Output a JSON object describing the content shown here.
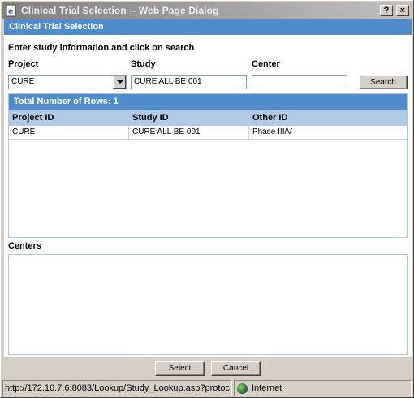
{
  "window": {
    "title": "Clinical Trial Selection -- Web Page Dialog",
    "help_label": "?",
    "close_label": "×"
  },
  "header": {
    "title": "Clinical Trial Selection"
  },
  "form": {
    "instruction": "Enter study information and click on search",
    "project_label": "Project",
    "study_label": "Study",
    "center_label": "Center",
    "project_value": "CURE",
    "study_value": "CURE ALL BE 001",
    "center_value": "",
    "search_label": "Search"
  },
  "results": {
    "title": "Total Number of Rows: 1",
    "columns": [
      "Project ID",
      "Study ID",
      "Other ID"
    ],
    "rows": [
      [
        "CURE",
        "CURE ALL BE 001",
        "Phase III/V"
      ]
    ]
  },
  "centers": {
    "label": "Centers"
  },
  "buttons": {
    "select_label": "Select",
    "cancel_label": "Cancel"
  },
  "statusbar": {
    "url": "http://172.16.7.6:8083/Lookup/Study_Lookup.asp?protoc",
    "zone": "Internet"
  },
  "colors": {
    "header": "#4f8ccc",
    "grid_header": "#b0cbe8",
    "titlebar": "#808080"
  },
  "icons": {
    "app": "ie-page-icon",
    "zone": "globe-icon"
  }
}
